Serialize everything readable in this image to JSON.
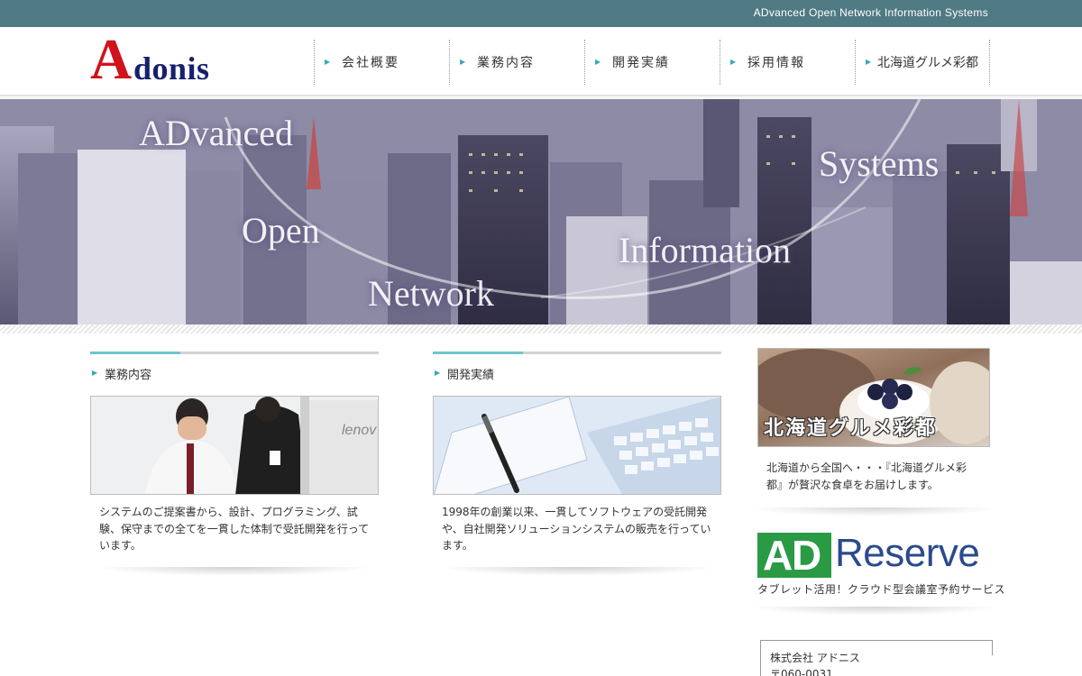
{
  "header": {
    "tagline": "ADvanced Open Network Information Systems",
    "logo": {
      "initial": "A",
      "rest": "donis"
    },
    "nav": [
      {
        "label": "会社概要"
      },
      {
        "label": "業務内容"
      },
      {
        "label": "開発実績"
      },
      {
        "label": "採用情報"
      },
      {
        "label": "北海道グルメ彩都"
      }
    ]
  },
  "hero": {
    "words": [
      "ADvanced",
      "Open",
      "Network",
      "Information",
      "Systems"
    ]
  },
  "sections": [
    {
      "title": "業務内容",
      "text": "システムのご提案書から、設計、プログラミング、試験、保守までの全てを一貫した体制で受託開発を行っています。"
    },
    {
      "title": "開発実績",
      "text": "1998年の創業以来、一貫してソフトウェアの受託開発や、自社開発ソリューションシステムの販売を行っています。"
    }
  ],
  "sidebar": {
    "gourmet_title": "北海道グルメ彩都",
    "gourmet_text": "北海道から全国へ・・・『北海道グルメ彩都』が贅沢な食卓をお届けします。",
    "reserve": {
      "a": "A",
      "d": "D",
      "word": "Reserve",
      "subtitle": "タブレット活用！クラウド型会議室予約サービス"
    },
    "company": {
      "name": "株式会社 アドニス",
      "zip": "〒060-0031"
    }
  },
  "colors": {
    "topbar": "#4f7a83",
    "logo_red": "#d0121b",
    "logo_navy": "#17206e",
    "accent": "#6cc7cb",
    "reserve_green": "#2a9a45",
    "reserve_blue": "#2b4a8c"
  }
}
